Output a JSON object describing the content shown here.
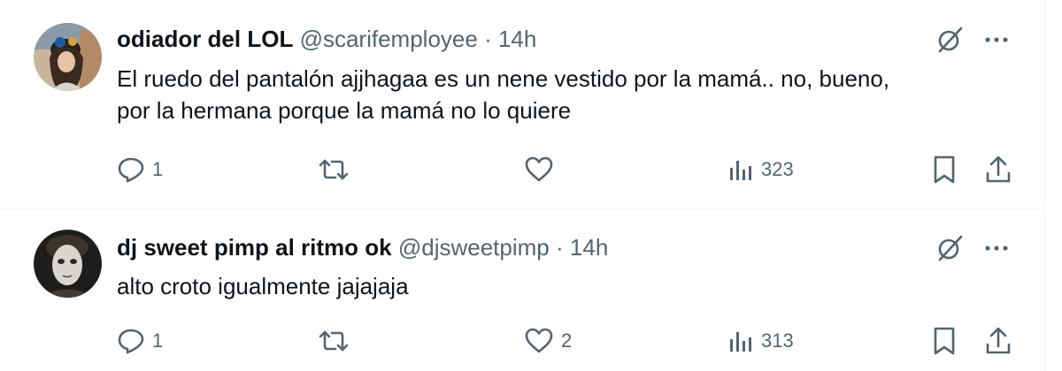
{
  "colors": {
    "text": "#0f1419",
    "secondary": "#536471",
    "divider": "#eff3f4",
    "background": "#ffffff"
  },
  "tweets": [
    {
      "display_name": "odiador del LOL",
      "handle": "@scarifemployee",
      "separator": "·",
      "time": "14h",
      "text_line1": "El ruedo del pantalón ajjhagaa es un nene vestido por la mamá.. no, bueno,",
      "text_line2": "por la hermana porque la mamá no lo quiere",
      "replies": "1",
      "retweets": "",
      "likes": "",
      "views": "323",
      "icons": [
        "grok-icon",
        "more-icon",
        "reply-icon",
        "retweet-icon",
        "like-icon",
        "views-icon",
        "bookmark-icon",
        "share-icon"
      ]
    },
    {
      "display_name": "dj sweet pimp al ritmo ok",
      "handle": "@djsweetpimp",
      "separator": "·",
      "time": "14h",
      "text_line1": "alto croto igualmente jajajaja",
      "replies": "1",
      "retweets": "",
      "likes": "2",
      "views": "313",
      "icons": [
        "grok-icon",
        "more-icon",
        "reply-icon",
        "retweet-icon",
        "like-icon",
        "views-icon",
        "bookmark-icon",
        "share-icon"
      ]
    }
  ]
}
